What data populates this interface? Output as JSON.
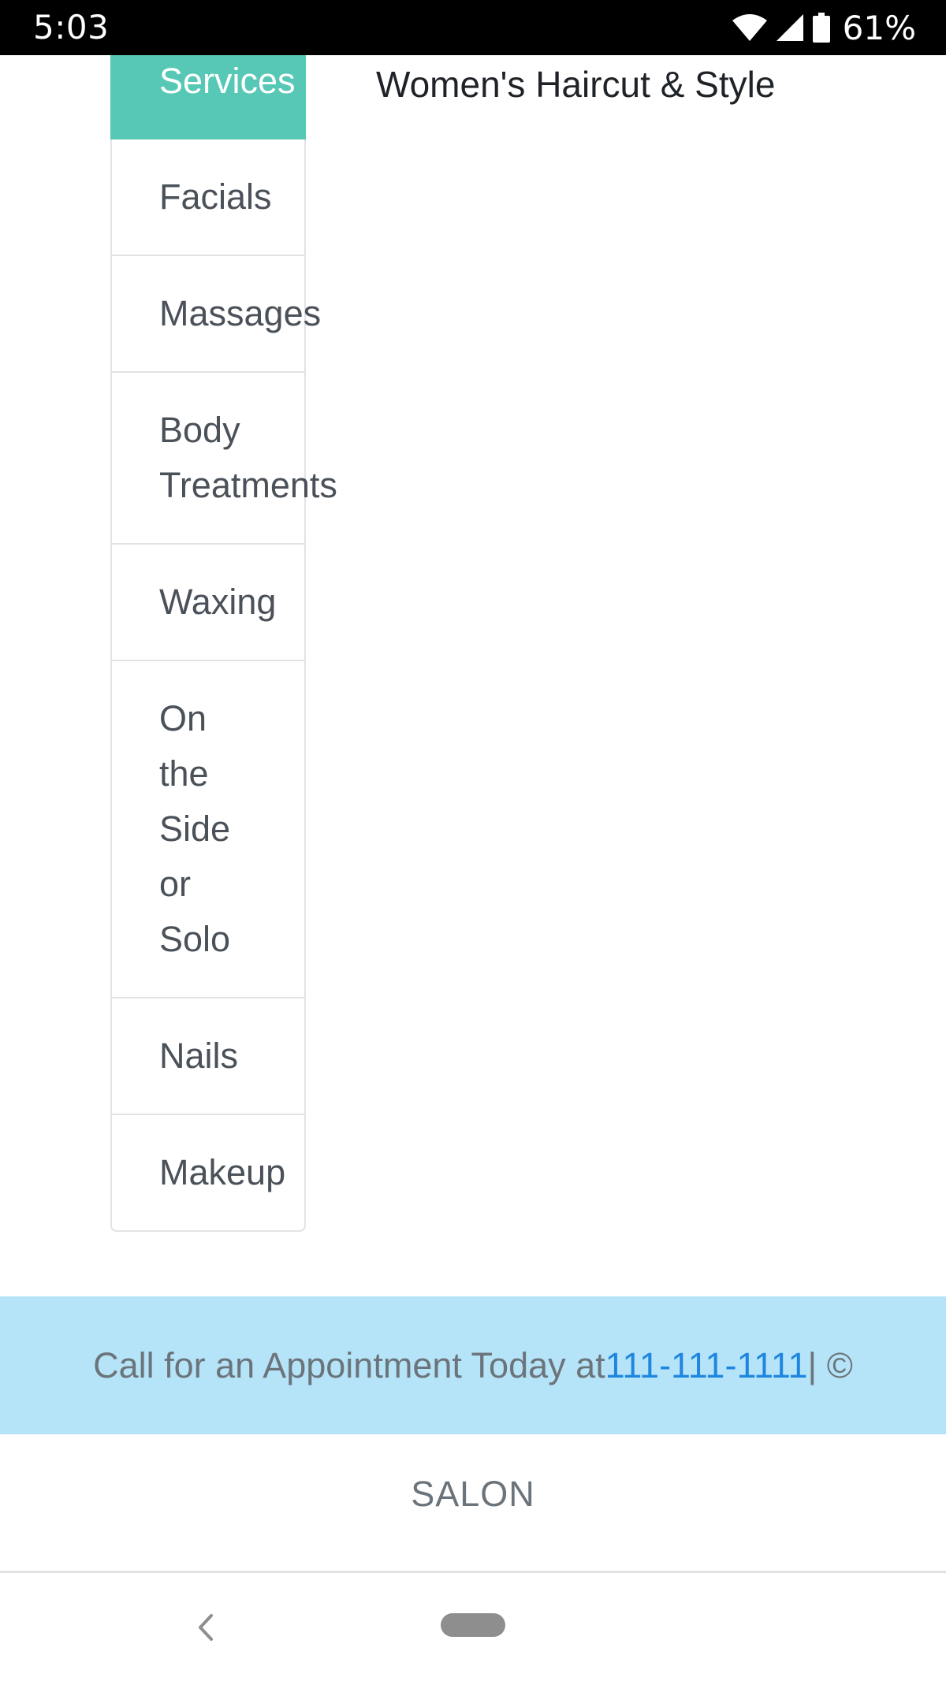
{
  "status_bar": {
    "time": "5:03",
    "battery": "61%",
    "icons": [
      "wifi-icon",
      "cellular-signal-icon",
      "battery-icon"
    ]
  },
  "menu": {
    "items": [
      {
        "label": "Services",
        "active": true
      },
      {
        "label": "Facials"
      },
      {
        "label": "Massages"
      },
      {
        "lines": [
          "Body",
          "Treatments"
        ]
      },
      {
        "label": "Waxing"
      },
      {
        "lines": [
          "On",
          "the",
          "Side",
          "or",
          "Solo"
        ]
      },
      {
        "label": "Nails"
      },
      {
        "label": "Makeup"
      }
    ]
  },
  "content": {
    "title": "Women's Haircut & Style"
  },
  "footer": {
    "text": "Call for an Appointment Today at ",
    "phone": "111-111-1111",
    "suffix": " | ©",
    "brand": "SALON"
  },
  "colors": {
    "accent": "#57c8b6",
    "footer_band": "#b5e4f8",
    "link": "#1f86e0"
  },
  "nav": {
    "icons": [
      "back-chevron-icon",
      "home-pill-icon"
    ]
  }
}
